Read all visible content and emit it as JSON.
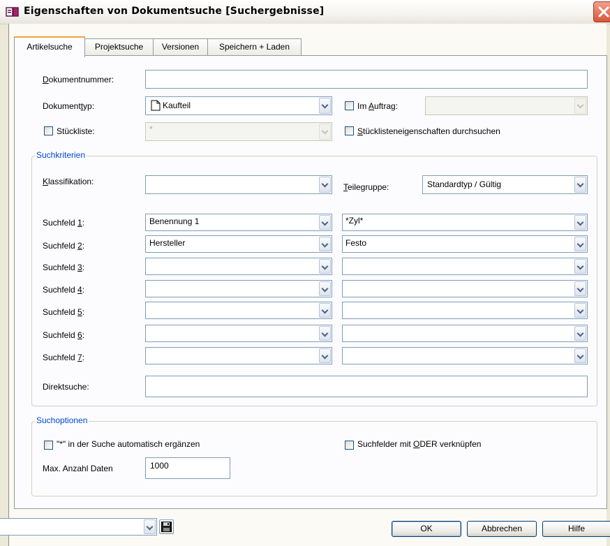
{
  "window": {
    "title": "Eigenschaften von Dokumentsuche [Suchergebnisse]"
  },
  "tabs": [
    {
      "label": "Artikelsuche",
      "active": true
    },
    {
      "label": "Projektsuche",
      "active": false
    },
    {
      "label": "Versionen",
      "active": false
    },
    {
      "label": "Speichern + Laden",
      "active": false
    }
  ],
  "header_fields": {
    "dokumentnummer": {
      "label_ul": "D",
      "label_rest": "okumentnummer:",
      "value": ""
    },
    "dokumenttyp": {
      "label_pre": "Dokument",
      "label_ul": "t",
      "label_post": "yp:",
      "value": "Kaufteil",
      "icon": "document-icon"
    },
    "im_auftrag": {
      "label_pre": "Im ",
      "label_ul": "A",
      "label_post": "uftrag:",
      "checked": false,
      "value": ""
    },
    "stueckliste": {
      "label": "Stückliste:",
      "checked": false,
      "value": "*"
    },
    "stuecklisteneigenschaften": {
      "label_ul": "S",
      "label_rest": "tücklisteneigenschaften durchsuchen",
      "checked": false
    }
  },
  "suchkriterien": {
    "title": "Suchkriterien",
    "klassifikation": {
      "label_ul": "K",
      "label_rest": "lassifikation:",
      "value": ""
    },
    "teilegruppe": {
      "label_ul": "T",
      "label_rest": "eilegruppe:",
      "value": "Standardtyp / Gültig"
    },
    "suchfelder": [
      {
        "label_pre": "Suchfeld ",
        "label_ul": "1",
        "label_post": ":",
        "field": "Benennung 1",
        "value": "*Zyl*"
      },
      {
        "label_pre": "Suchfeld ",
        "label_ul": "2",
        "label_post": ":",
        "field": "Hersteller",
        "value": "Festo"
      },
      {
        "label_pre": "Suchfeld ",
        "label_ul": "3",
        "label_post": ":",
        "field": "",
        "value": ""
      },
      {
        "label_pre": "Suchfeld ",
        "label_ul": "4",
        "label_post": ":",
        "field": "",
        "value": ""
      },
      {
        "label_pre": "Suchfeld ",
        "label_ul": "5",
        "label_post": ":",
        "field": "",
        "value": ""
      },
      {
        "label_pre": "Suchfeld ",
        "label_ul": "6",
        "label_post": ":",
        "field": "",
        "value": ""
      },
      {
        "label_pre": "Suchfeld ",
        "label_ul": "7",
        "label_post": ":",
        "field": "",
        "value": ""
      }
    ],
    "direktsuche": {
      "label": "Direktsuche:",
      "value": ""
    }
  },
  "suchoptionen": {
    "title": "Suchoptionen",
    "auto_ergaenzen": {
      "label": "\"*\" in der Suche automatisch ergänzen",
      "checked": false
    },
    "oder_verknuepfen": {
      "label_pre": "Suchfelder mit ",
      "label_ul": "O",
      "label_post": "DER verknüpfen",
      "checked": false
    },
    "max_anzahl": {
      "label": "Max. Anzahl Daten",
      "value": "1000"
    }
  },
  "footer": {
    "preset_value": "",
    "save_icon": "floppy-disk-icon",
    "ok_label": "OK",
    "cancel_label": "Abbrechen",
    "help_label": "Hilfe"
  },
  "colors": {
    "group_title": "#0046d5",
    "active_tab_accent": "#f4a23c",
    "close_button": "#d9543a"
  }
}
